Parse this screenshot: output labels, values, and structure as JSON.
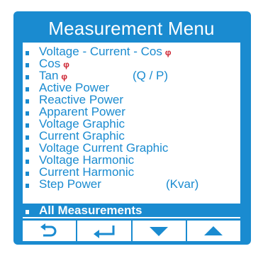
{
  "title": "Measurement Menu",
  "menu": {
    "items": [
      {
        "label": "Voltage - Current - Cos",
        "symbol": "φ",
        "extra": ""
      },
      {
        "label": "Cos",
        "symbol": "φ",
        "extra": ""
      },
      {
        "label": "Tan",
        "symbol": "φ",
        "extra": "(Q / P)"
      },
      {
        "label": "Active Power",
        "symbol": "",
        "extra": ""
      },
      {
        "label": "Reactive Power",
        "symbol": "",
        "extra": ""
      },
      {
        "label": "Apparent Power",
        "symbol": "",
        "extra": ""
      },
      {
        "label": "Voltage Graphic",
        "symbol": "",
        "extra": ""
      },
      {
        "label": "Current Graphic",
        "symbol": "",
        "extra": ""
      },
      {
        "label": "Voltage Current Graphic",
        "symbol": "",
        "extra": ""
      },
      {
        "label": "Voltage Harmonic",
        "symbol": "",
        "extra": ""
      },
      {
        "label": "Current Harmonic",
        "symbol": "",
        "extra": ""
      },
      {
        "label": "Step Power",
        "symbol": "",
        "extra": "(Kvar)"
      },
      {
        "label": "All Measurements",
        "symbol": "",
        "extra": "",
        "selected": true
      }
    ]
  },
  "buttons": [
    {
      "icon": "back-arrow-icon"
    },
    {
      "icon": "enter-return-icon"
    },
    {
      "icon": "arrow-down-icon"
    },
    {
      "icon": "arrow-up-icon"
    }
  ],
  "colors": {
    "accent": "#1a8bd0",
    "phi_symbol": "#cc1f2d",
    "background": "#ffffff"
  }
}
